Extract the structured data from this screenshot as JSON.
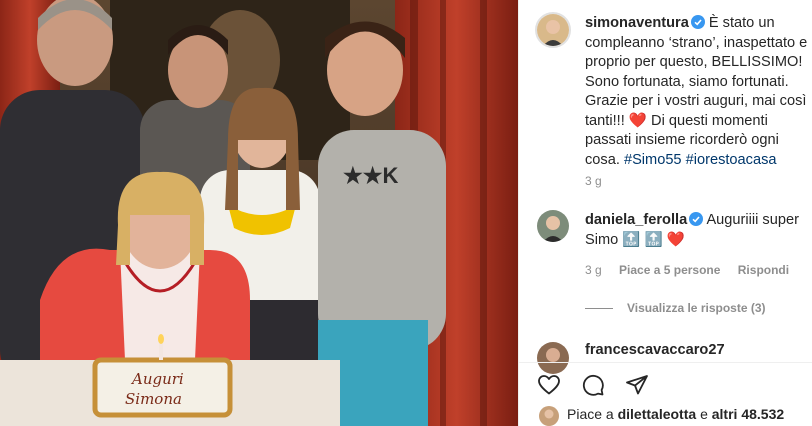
{
  "post": {
    "author": "simonaventura",
    "caption": "È stato un compleanno ‘strano’, inaspettato e proprio per questo, BELLISSIMO! Sono fortunata, siamo fortunati. Grazie per i vostri auguri, mai così tanti!!! ❤️ Di questi momenti passati insieme ricorderò ogni cosa.",
    "hashtag1": "#Simo55",
    "hashtag2": "#iorestoacasa",
    "time": "3 g"
  },
  "photo": {
    "cake_text_line1": "Auguri",
    "cake_text_line2": "Simona",
    "shirt_text": "★★K"
  },
  "comments": [
    {
      "username": "daniela_ferolla",
      "text": "Auguriiii super Simo",
      "emoji": "🔝 🔝 ❤️",
      "time": "3 g",
      "likes": "Piace a 5 persone",
      "reply": "Rispondi",
      "view_replies": "Visualizza le risposte (3)"
    },
    {
      "username": "francescavaccaro27"
    }
  ],
  "likes": {
    "prefix": "Piace a",
    "user": "dilettaleotta",
    "middle": "e",
    "others": "altri 48.532"
  },
  "colors": {
    "link": "#00376b",
    "muted": "#8e8e8e",
    "heart": "#ed4956",
    "verified": "#3897f0"
  },
  "icons": [
    "heart-icon",
    "comment-icon",
    "share-icon"
  ]
}
